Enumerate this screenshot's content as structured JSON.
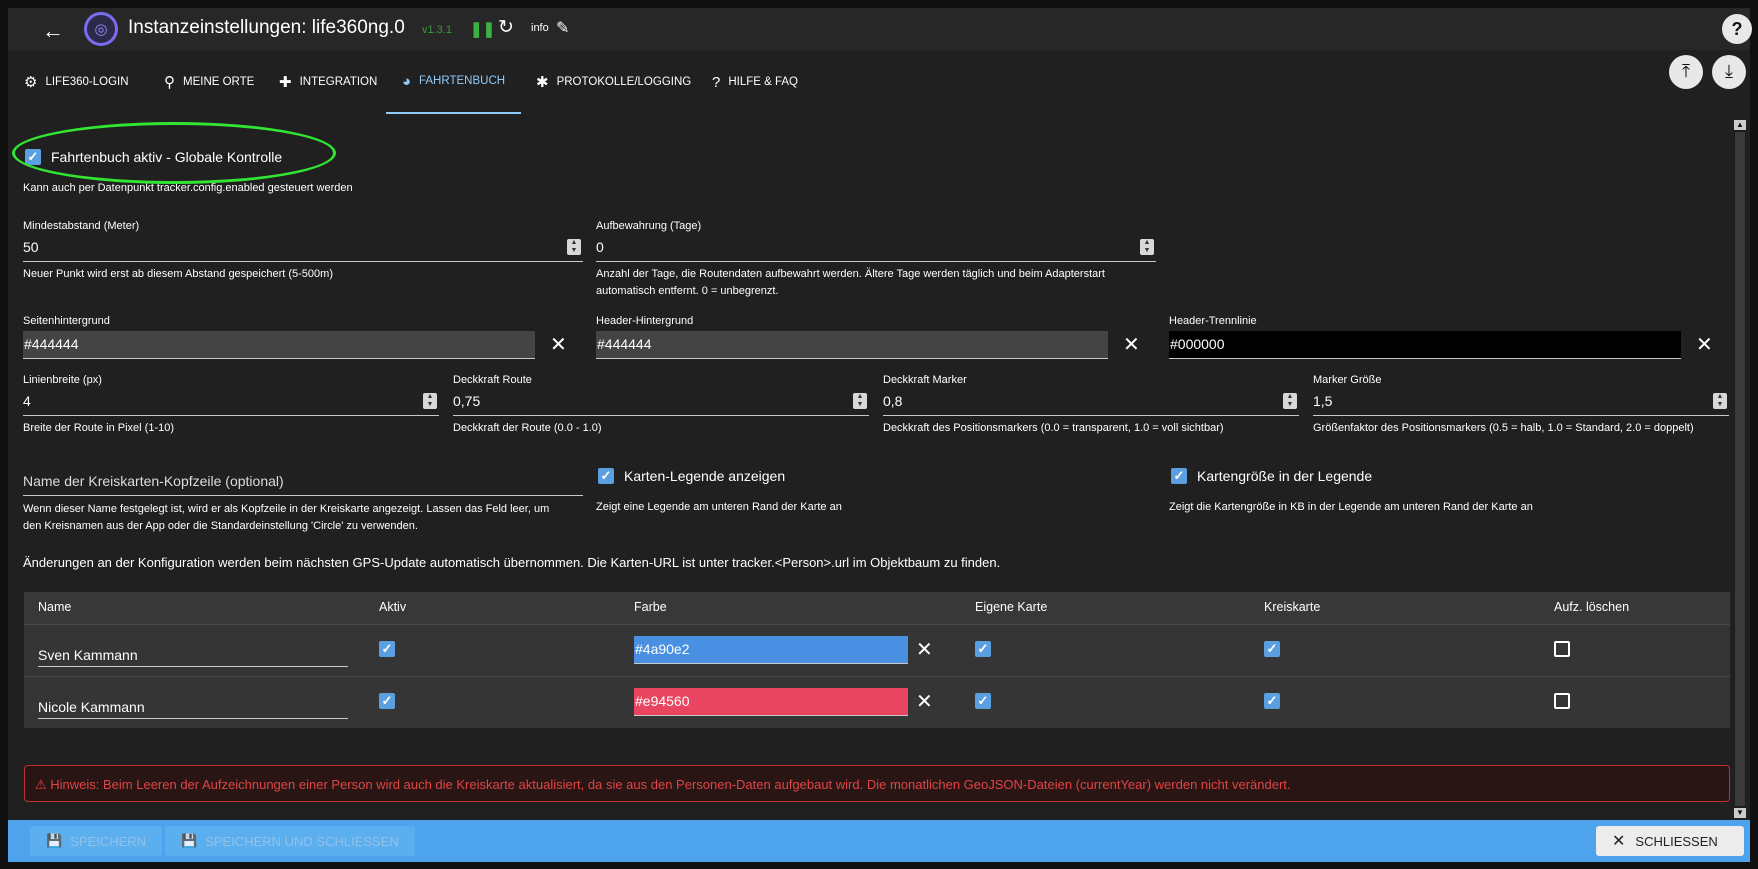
{
  "header": {
    "title": "Instanzeinstellungen: life360ng.0",
    "version": "v1.3.1",
    "info_label": "info"
  },
  "tabs": [
    {
      "label": "LIFE360-LOGIN",
      "icon": "gear-icon"
    },
    {
      "label": "MEINE ORTE",
      "icon": "location-pin-icon"
    },
    {
      "label": "INTEGRATION",
      "icon": "puzzle-icon"
    },
    {
      "label": "FAHRTENBUCH",
      "icon": "globe-icon"
    },
    {
      "label": "PROTOKOLLE/LOGGING",
      "icon": "bug-icon"
    },
    {
      "label": "HILFE & FAQ",
      "icon": "help-circle-icon"
    }
  ],
  "tracker": {
    "enabled_label": "Fahrtenbuch aktiv - Globale Kontrolle",
    "enabled_help": "Kann auch per Datenpunkt tracker.config.enabled gesteuert werden",
    "min_distance": {
      "label": "Mindestabstand (Meter)",
      "value": "50",
      "help": "Neuer Punkt wird erst ab diesem Abstand gespeichert (5-500m)"
    },
    "retention": {
      "label": "Aufbewahrung (Tage)",
      "value": "0",
      "help_1": "Anzahl der Tage, die Routendaten aufbewahrt werden. Ältere Tage werden täglich und beim Adapterstart",
      "help_2": "automatisch entfernt. 0 = unbegrenzt."
    },
    "page_bg": {
      "label": "Seitenhintergrund",
      "value": "#444444"
    },
    "header_bg": {
      "label": "Header-Hintergrund",
      "value": "#444444"
    },
    "header_line": {
      "label": "Header-Trennlinie",
      "value": "#000000"
    },
    "line_width": {
      "label": "Linienbreite (px)",
      "value": "4",
      "help": "Breite der Route in Pixel (1-10)"
    },
    "route_opacity": {
      "label": "Deckkraft Route",
      "value": "0,75",
      "help": "Deckkraft der Route (0.0 - 1.0)"
    },
    "marker_opacity": {
      "label": "Deckkraft Marker",
      "value": "0,8",
      "help": "Deckkraft des Positionsmarkers (0.0 = transparent, 1.0 = voll sichtbar)"
    },
    "marker_size": {
      "label": "Marker Größe",
      "value": "1,5",
      "help": "Größenfaktor des Positionsmarkers (0.5 = halb, 1.0 = Standard, 2.0 = doppelt)"
    },
    "circle_header": {
      "placeholder": "Name der Kreiskarten-Kopfzeile (optional)",
      "help_1": "Wenn dieser Name festgelegt ist, wird er als Kopfzeile in der Kreiskarte angezeigt. Lassen das Feld leer, um",
      "help_2": "den Kreisnamen aus der App oder die Standardeinstellung 'Circle' zu verwenden."
    },
    "show_legend": {
      "label": "Karten-Legende anzeigen",
      "help": "Zeigt eine Legende am unteren Rand der Karte an"
    },
    "map_size": {
      "label": "Kartengröße in der Legende",
      "help": "Zeigt die Kartengröße in KB in der Legende am unteren Rand der Karte an"
    },
    "notice": "Änderungen an der Konfiguration werden beim nächsten GPS-Update automatisch übernommen. Die Karten-URL ist unter tracker.<Person>.url im Objektbaum zu finden."
  },
  "table": {
    "columns": [
      "Name",
      "Aktiv",
      "Farbe",
      "Eigene Karte",
      "Kreiskarte",
      "Aufz. löschen"
    ],
    "rows": [
      {
        "name": "Sven Kammann",
        "color": "#4a90e2",
        "aktiv": true,
        "eigene": true,
        "kreis": true,
        "loeschen": false
      },
      {
        "name": "Nicole Kammann",
        "color": "#e94560",
        "aktiv": true,
        "eigene": true,
        "kreis": true,
        "loeschen": false
      }
    ]
  },
  "warning": "⚠ Hinweis: Beim Leeren der Aufzeichnungen einer Person wird auch die Kreiskarte aktualisiert, da sie aus den Personen-Daten aufgebaut wird. Die monatlichen GeoJSON-Dateien (currentYear) werden nicht verändert.",
  "footer": {
    "save": "SPEICHERN",
    "save_close": "SPEICHERN UND SCHLIESSEN",
    "close": "SCHLIESSEN"
  }
}
